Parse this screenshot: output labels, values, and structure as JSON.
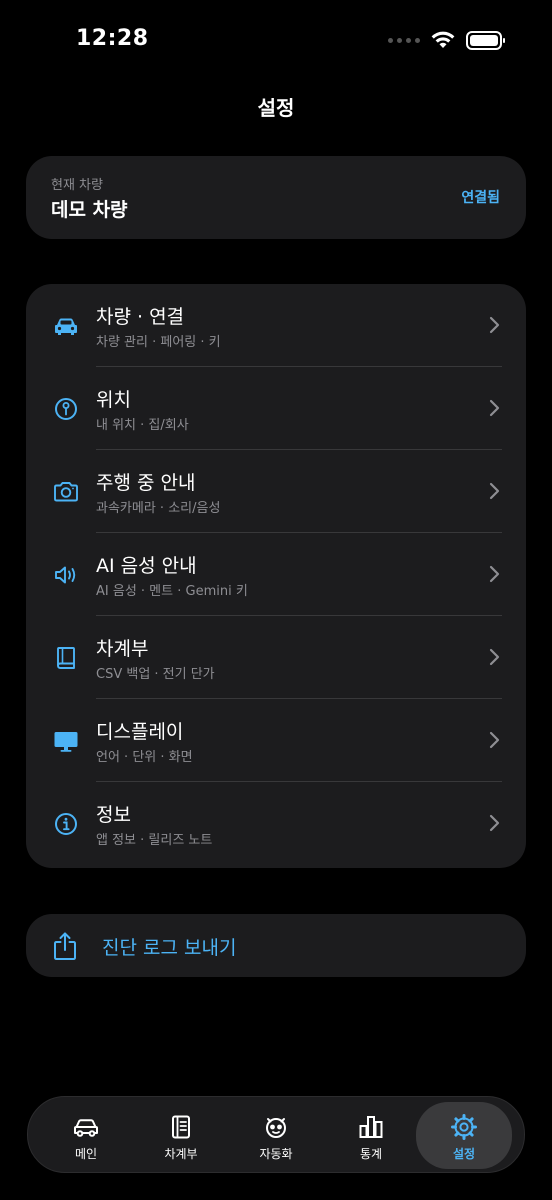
{
  "status_bar": {
    "time": "12:28",
    "battery_level": 1.0
  },
  "header": {
    "title": "설정"
  },
  "vehicle": {
    "caption": "현재 차량",
    "name": "데모 차량",
    "status": "연결됨"
  },
  "menu": {
    "items": [
      {
        "title": "차량 · 연결",
        "subtitle": "차량 관리 · 페어링 · 키",
        "icon": "car-icon"
      },
      {
        "title": "위치",
        "subtitle": "내 위치 · 집/회사",
        "icon": "location-pin-icon"
      },
      {
        "title": "주행 중 안내",
        "subtitle": "과속카메라 · 소리/음성",
        "icon": "camera-icon"
      },
      {
        "title": "AI 음성 안내",
        "subtitle": "AI 음성 · 멘트 · Gemini 키",
        "icon": "speaker-icon"
      },
      {
        "title": "차계부",
        "subtitle": "CSV 백업 · 전기 단가",
        "icon": "book-icon"
      },
      {
        "title": "디스플레이",
        "subtitle": "언어 · 단위 · 화면",
        "icon": "display-icon"
      },
      {
        "title": "정보",
        "subtitle": "앱 정보 · 릴리즈 노트",
        "icon": "info-icon"
      }
    ]
  },
  "actions": {
    "send_logs": "진단 로그 보내기",
    "icon": "share-icon"
  },
  "tabs": [
    {
      "label": "메인",
      "icon": "car-icon",
      "active": false
    },
    {
      "label": "차계부",
      "icon": "notebook-icon",
      "active": false
    },
    {
      "label": "자동화",
      "icon": "robot-icon",
      "active": false
    },
    {
      "label": "통계",
      "icon": "bar-chart-icon",
      "active": false
    },
    {
      "label": "설정",
      "icon": "gear-icon",
      "active": true
    }
  ],
  "colors": {
    "accent": "#4cb3f5",
    "card": "#1c1c1e",
    "background": "#000000",
    "secondary_text": "#8e8e93"
  }
}
